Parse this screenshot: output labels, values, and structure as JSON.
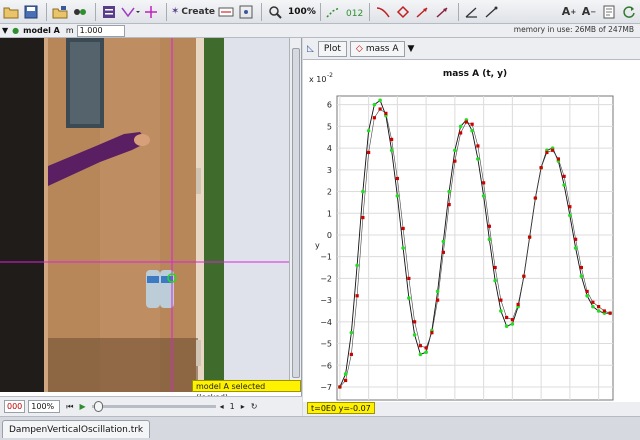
{
  "toolbar": {
    "create_label": "Create",
    "zoom_label": "100%"
  },
  "trackbar": {
    "track_name": "model A",
    "mass_label": "m",
    "mass_value": "1.000",
    "memory": "memory in use: 26MB of 247MB"
  },
  "video": {
    "selection_label": "model A selected (locked)"
  },
  "player": {
    "frame": "000",
    "zoom": "100%",
    "step": "1"
  },
  "plot": {
    "tab_plot": "Plot",
    "tab_track": "mass A",
    "readout": "t=0E0  y=-0.07"
  },
  "files": {
    "tab": "DampenVerticalOscillation.trk"
  },
  "colors": {
    "model_line": "#111111",
    "data_points": "#cc0000",
    "model_points": "#22dd22",
    "crosshair": "#dd22dd",
    "label_bg": "#fff200"
  },
  "chart_data": {
    "type": "scatter",
    "title": "mass A (t, y)",
    "xlabel": "t",
    "ylabel": "y",
    "y_multiplier_label": "x 10",
    "y_multiplier_exp": "-2",
    "xlim": [
      -0.05,
      4.75
    ],
    "ylim": [
      -7.6,
      6.4
    ],
    "x_ticks": [
      "0",
      "0.5",
      "1",
      "1.5",
      "2",
      "2.5",
      "3",
      "3.5",
      "4",
      "4.5"
    ],
    "y_ticks": [
      "6",
      "5",
      "4",
      "3",
      "2",
      "1",
      "0",
      "−1",
      "−2",
      "−3",
      "−4",
      "−5",
      "−6",
      "−7"
    ],
    "grid": true,
    "series": [
      {
        "kind": "data",
        "x": [
          0.0,
          0.1,
          0.2,
          0.3,
          0.4,
          0.5,
          0.6,
          0.7,
          0.8,
          0.9,
          1.0,
          1.1,
          1.2,
          1.3,
          1.4,
          1.5,
          1.6,
          1.7,
          1.8,
          1.9,
          2.0,
          2.1,
          2.2,
          2.3,
          2.4,
          2.5,
          2.6,
          2.7,
          2.8,
          2.9,
          3.0,
          3.1,
          3.2,
          3.3,
          3.4,
          3.5,
          3.6,
          3.7,
          3.8,
          3.9,
          4.0,
          4.1,
          4.2,
          4.3,
          4.4,
          4.5,
          4.6,
          4.7
        ],
        "y": [
          -7.0,
          -6.7,
          -5.5,
          -2.8,
          0.8,
          3.8,
          5.4,
          5.8,
          5.6,
          4.4,
          2.6,
          0.3,
          -2.0,
          -4.0,
          -5.1,
          -5.2,
          -4.5,
          -3.0,
          -0.8,
          1.4,
          3.4,
          4.7,
          5.2,
          5.1,
          4.1,
          2.4,
          0.4,
          -1.5,
          -3.0,
          -3.8,
          -3.9,
          -3.2,
          -1.9,
          -0.1,
          1.7,
          3.1,
          3.8,
          3.9,
          3.5,
          2.7,
          1.3,
          -0.2,
          -1.5,
          -2.6,
          -3.1,
          -3.3,
          -3.5,
          -3.6
        ]
      },
      {
        "kind": "model",
        "x": [
          0.0,
          0.1,
          0.2,
          0.3,
          0.4,
          0.5,
          0.6,
          0.7,
          0.8,
          0.9,
          1.0,
          1.1,
          1.2,
          1.3,
          1.4,
          1.5,
          1.6,
          1.7,
          1.8,
          1.9,
          2.0,
          2.1,
          2.2,
          2.3,
          2.4,
          2.5,
          2.6,
          2.7,
          2.8,
          2.9,
          3.0,
          3.1,
          3.2,
          3.3,
          3.4,
          3.5,
          3.6,
          3.7,
          3.8,
          3.9,
          4.0,
          4.1,
          4.2,
          4.3,
          4.4,
          4.5,
          4.6,
          4.7
        ],
        "y": [
          -7.0,
          -6.4,
          -4.5,
          -1.4,
          2.0,
          4.8,
          6.0,
          6.2,
          5.5,
          3.9,
          1.8,
          -0.6,
          -2.9,
          -4.6,
          -5.5,
          -5.4,
          -4.4,
          -2.6,
          -0.3,
          2.0,
          3.9,
          5.0,
          5.3,
          4.8,
          3.5,
          1.8,
          -0.2,
          -2.1,
          -3.5,
          -4.2,
          -4.1,
          -3.3,
          -1.9,
          -0.1,
          1.7,
          3.1,
          3.9,
          4.0,
          3.4,
          2.3,
          0.9,
          -0.6,
          -1.9,
          -2.8,
          -3.3,
          -3.5,
          -3.6,
          -3.6
        ]
      }
    ]
  }
}
